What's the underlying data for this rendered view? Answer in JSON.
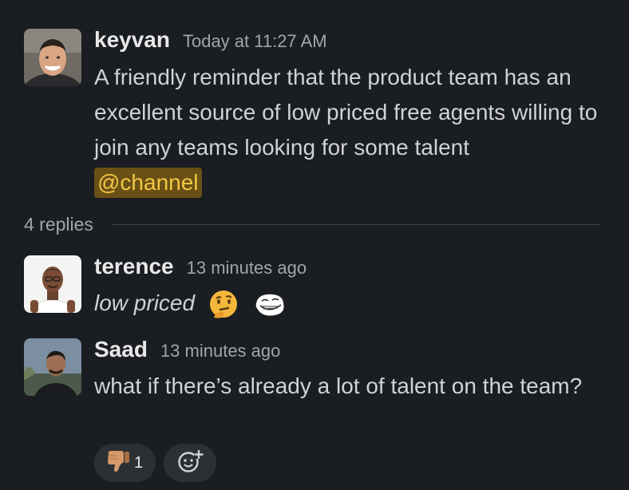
{
  "parent_message": {
    "author": "keyvan",
    "timestamp": "Today at 11:27 AM",
    "text": "A friendly reminder that the product team has an excellent source of low priced free agents willing to join any teams looking for some talent",
    "mention": "@channel"
  },
  "thread": {
    "replies_label": "4 replies"
  },
  "replies": [
    {
      "author": "terence",
      "timestamp": "13 minutes ago",
      "text": "low priced",
      "emojis": [
        "thinking-face",
        "trollface"
      ]
    },
    {
      "author": "Saad",
      "timestamp": "13 minutes ago",
      "text": "what if there’s already a lot of talent on the team?",
      "reactions": [
        {
          "emoji": "thumbs-down",
          "count": "1"
        }
      ]
    }
  ],
  "colors": {
    "background": "#1a1d21",
    "mention_bg": "#6b5016",
    "mention_text": "#f2c744",
    "reaction_bg": "#2c2f33"
  }
}
